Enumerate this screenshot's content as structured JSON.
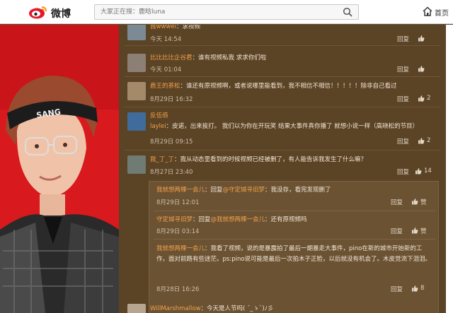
{
  "header": {
    "logo_text": "微博",
    "search_placeholder": "大家正在搜：鹿晗luna",
    "home_label": "首页"
  },
  "colors": {
    "panel_bg": "#5b4326",
    "username": "#f0a14a",
    "text": "#f1e6d4",
    "photo_bg": "#d8191d"
  },
  "icons": {
    "logo": "weibo-eye-icon",
    "search": "search-icon",
    "home": "home-icon",
    "like": "thumbs-up-icon"
  },
  "comments": [
    {
      "user": "我wwwei",
      "text": "：求视频",
      "time": "今天 14:54",
      "reply": "回复",
      "likes": ""
    },
    {
      "user": "比比比比企谷君",
      "text": "：谁有视频私我  求求你们啦",
      "time": "今天 01:04",
      "reply": "回复",
      "likes": ""
    },
    {
      "user": "鹿王的茶松",
      "text": "：谁还有原视频啊，或者说哪里能看到，我不相信不相信！！！！！除非自己看过",
      "time": "8月29日 16:32",
      "reply": "回复",
      "likes": "2"
    },
    {
      "user": "反伍佰laylei",
      "text": "：皮诺，出来挨打。 我们以为你在开玩笑 结果大事件真你播了 就想小说一样（高晓松的节目）",
      "time": "8月29日 09:15",
      "reply": "回复",
      "likes": "2"
    },
    {
      "user": "我_丁_丁",
      "text": "：我从动态里看到的时候视频已经被删了，有人能告诉我发生了什么嘛？",
      "time": "8月27日 23:40",
      "reply": "回复",
      "likes": "14"
    },
    {
      "user": "WillMarshmallow",
      "text": "：今天是人节吗( ´_ゝ`)ﾉ彡",
      "time": "",
      "reply": "",
      "likes": ""
    }
  ],
  "replies": [
    {
      "user": "我就想两棵一会儿",
      "reply_word": "：回复",
      "mention": "@守定城寻旧梦",
      "text": "：我没存，看完发现删了",
      "time": "8月29日 12:01",
      "reply": "回复",
      "likes": "赞"
    },
    {
      "user": "守定城寻旧梦",
      "reply_word": "：回复",
      "mention": "@我就想两棵一会儿",
      "text": "：还有原视频吗",
      "time": "8月29日 03:14",
      "reply": "回复",
      "likes": "赞"
    },
    {
      "user": "我就想两棵一会儿",
      "reply_word": "：",
      "mention": "",
      "text": "我看了视频，说的是暴露拍了最后一期暴走大事件，pino在新的城市开始新的工作，面对前路有些迷茫。ps:pino说可能是最后一次拍木子正脸，以后就没有机会了。木皮觉流下泪泪。",
      "time": "8月28日 16:26",
      "reply": "回复",
      "likes": "8"
    }
  ]
}
